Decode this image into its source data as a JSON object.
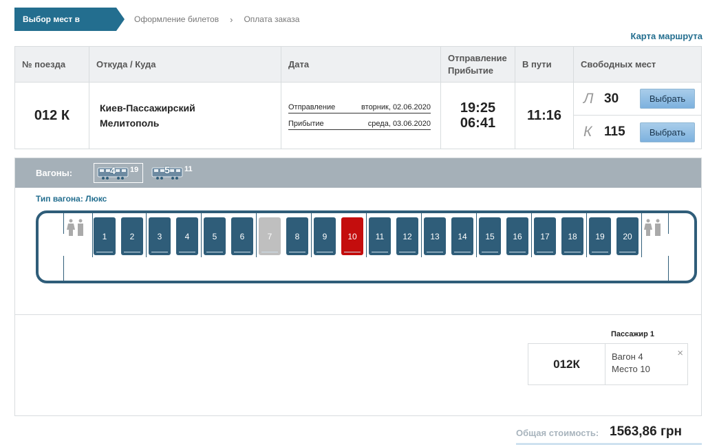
{
  "breadcrumb": {
    "step1": "Выбор мест в поезде",
    "step2": "Оформление билетов",
    "step3": "Оплата заказа",
    "sep": "›"
  },
  "route_map": "Карта маршрута",
  "table": {
    "headers": {
      "train": "№ поезда",
      "from_to": "Откуда / Куда",
      "date": "Дата",
      "dep_arr_1": "Отправление",
      "dep_arr_2": "Прибытие",
      "travel": "В пути",
      "free": "Свободных мест"
    },
    "train_number": "012 К",
    "from": "Киев-Пассажирский",
    "to": "Мелитополь",
    "departure_label": "Отправление",
    "departure_date": "вторник, 02.06.2020",
    "arrival_label": "Прибытие",
    "arrival_date": "среда, 03.06.2020",
    "departure_time": "19:25",
    "arrival_time": "06:41",
    "travel_time": "11:16",
    "classes": [
      {
        "type": "Л",
        "count": "30",
        "button": "Выбрать"
      },
      {
        "type": "К",
        "count": "115",
        "button": "Выбрать"
      }
    ]
  },
  "wagons": {
    "label": "Вагоны:",
    "items": [
      {
        "number": "4",
        "free": "19",
        "active": true
      },
      {
        "number": "5",
        "free": "11",
        "active": false
      }
    ],
    "type_text": "Тип вагона: Люкс",
    "seats": [
      "1",
      "2",
      "3",
      "4",
      "5",
      "6",
      "7",
      "8",
      "9",
      "10",
      "11",
      "12",
      "13",
      "14",
      "15",
      "16",
      "17",
      "18",
      "19",
      "20"
    ],
    "taken_seats": [
      "7"
    ],
    "selected_seat": "10"
  },
  "passenger": {
    "title": "Пассажир 1",
    "train": "012К",
    "wagon": "Вагон 4",
    "seat": "Место 10",
    "close": "×"
  },
  "total": {
    "label": "Общая стоимость:",
    "value": "1563,86 грн"
  },
  "colors": {
    "accent": "#236e8f",
    "seat": "#2f5d79",
    "seat_taken": "#bfbfbf",
    "seat_selected": "#c40d0d"
  }
}
